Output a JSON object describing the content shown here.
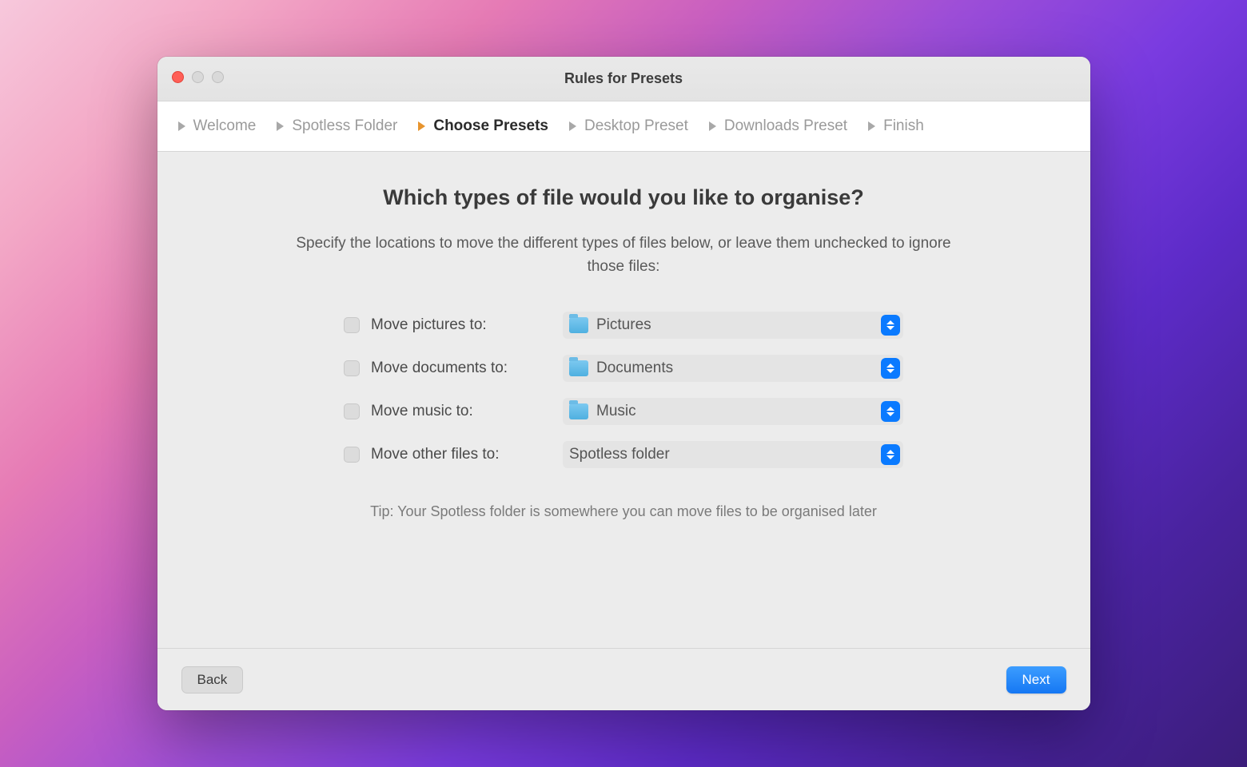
{
  "window": {
    "title": "Rules for Presets"
  },
  "steps": [
    {
      "label": "Welcome",
      "active": false
    },
    {
      "label": "Spotless Folder",
      "active": false
    },
    {
      "label": "Choose Presets",
      "active": true
    },
    {
      "label": "Desktop Preset",
      "active": false
    },
    {
      "label": "Downloads Preset",
      "active": false
    },
    {
      "label": "Finish",
      "active": false
    }
  ],
  "content": {
    "heading": "Which types of file would you like to organise?",
    "subtext": "Specify the locations to move the different types of files below, or leave them unchecked to ignore those files:",
    "tip": "Tip: Your Spotless folder is somewhere you can move files to be organised later"
  },
  "rows": [
    {
      "label": "Move pictures to:",
      "dest": "Pictures",
      "has_folder_icon": true,
      "checked": false
    },
    {
      "label": "Move documents to:",
      "dest": "Documents",
      "has_folder_icon": true,
      "checked": false
    },
    {
      "label": "Move music to:",
      "dest": "Music",
      "has_folder_icon": true,
      "checked": false
    },
    {
      "label": "Move other files to:",
      "dest": "Spotless folder",
      "has_folder_icon": false,
      "checked": false
    }
  ],
  "footer": {
    "back": "Back",
    "next": "Next"
  }
}
